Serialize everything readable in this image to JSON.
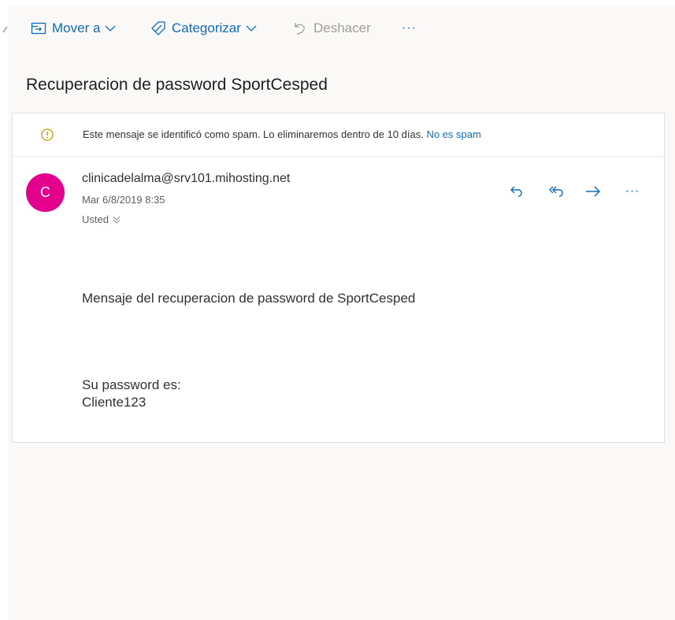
{
  "toolbar": {
    "move_label": "Mover a",
    "categorize_label": "Categorizar",
    "undo_label": "Deshacer",
    "more_label": "···"
  },
  "message": {
    "subject": "Recuperacion de password SportCesped",
    "spam_notice": "Este mensaje se identificó como spam. Lo eliminaremos dentro de 10 días.",
    "spam_link": "No es spam",
    "avatar_initial": "C",
    "sender": "clinicadelalma@srv101.mihosting.net",
    "date": "Mar 6/8/2019 8:35",
    "to": "Usted",
    "more_actions": "···",
    "body_line1": "Mensaje del recuperacion de password de SportCesped",
    "body_line2": "Su password es:",
    "body_line3": "Cliente123"
  },
  "colors": {
    "accent": "#0f6cbd",
    "avatar": "#e3008c",
    "warning": "#c19c00",
    "disabled": "#a19f9d"
  },
  "icons": [
    "chevron-left-icon",
    "move-folder-icon",
    "chevron-down-icon",
    "tag-icon",
    "undo-icon",
    "more-icon",
    "warning-icon",
    "reply-icon",
    "reply-all-icon",
    "forward-icon"
  ]
}
